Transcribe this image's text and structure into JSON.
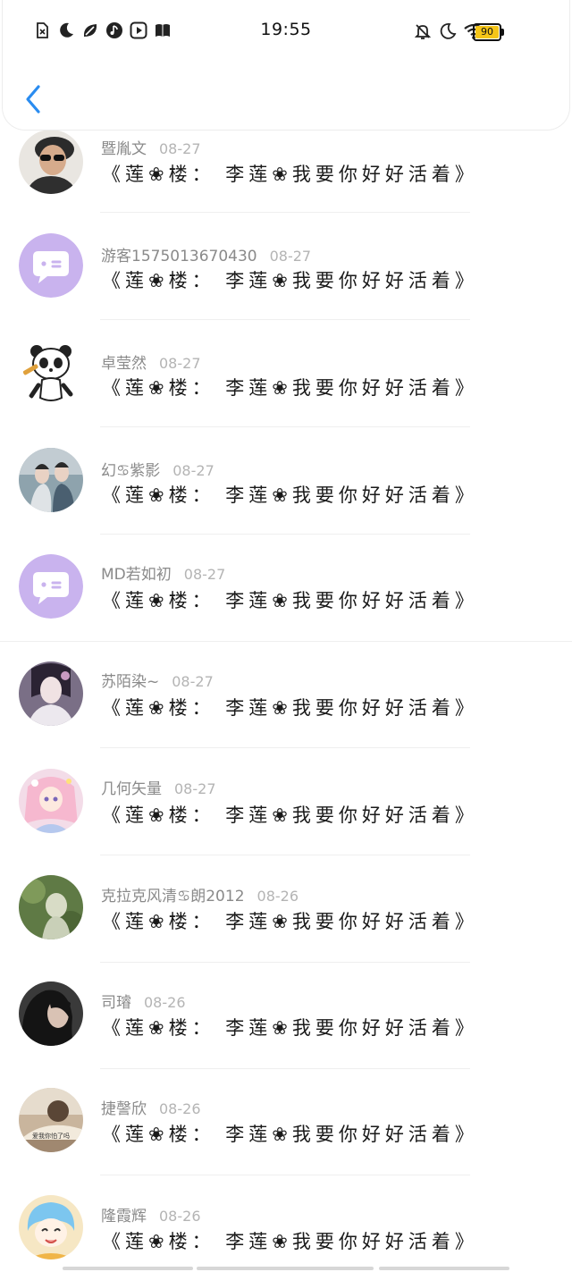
{
  "status_bar": {
    "time": "19:55",
    "battery": "90",
    "left_icons": [
      "sim-off-icon",
      "moon-icon",
      "leaf-icon",
      "music-icon",
      "video-play-icon",
      "book-icon"
    ],
    "right_icons": [
      "bell-off-icon",
      "moon-icon",
      "wifi-icon",
      "battery-icon"
    ]
  },
  "header": {
    "back_icon": "chevron-left-icon"
  },
  "comments": [
    {
      "name": "暨胤文",
      "date": "08-27",
      "text": "《莲❀楼： 李莲❀我要你好好活着》",
      "avatar": "photo-man-sunglasses"
    },
    {
      "name": "游客1575013670430",
      "date": "08-27",
      "text": "《莲❀楼： 李莲❀我要你好好活着》",
      "avatar": "default-chat-bubble"
    },
    {
      "name": "卓莹然",
      "date": "08-27",
      "text": "《莲❀楼： 李莲❀我要你好好活着》",
      "avatar": "cartoon-panda"
    },
    {
      "name": "幻♋紫影",
      "date": "08-27",
      "text": "《莲❀楼： 李莲❀我要你好好活着》",
      "avatar": "photo-drama-couple"
    },
    {
      "name": "MD若如初",
      "date": "08-27",
      "text": "《莲❀楼： 李莲❀我要你好好活着》",
      "avatar": "default-chat-bubble"
    },
    {
      "name": "苏陌染~",
      "date": "08-27",
      "text": "《莲❀楼： 李莲❀我要你好好活着》",
      "avatar": "photo-costume-woman"
    },
    {
      "name": "几何矢量",
      "date": "08-27",
      "text": "《莲❀楼： 李莲❀我要你好好活着》",
      "avatar": "anime-girl-pink"
    },
    {
      "name": "克拉克风清♋朗2012",
      "date": "08-26",
      "text": "《莲❀楼： 李莲❀我要你好好活着》",
      "avatar": "photo-green-garden"
    },
    {
      "name": "司璿",
      "date": "08-26",
      "text": "《莲❀楼： 李莲❀我要你好好活着》",
      "avatar": "photo-dark-portrait"
    },
    {
      "name": "捷謦欣",
      "date": "08-26",
      "text": "《莲❀楼： 李莲❀我要你好好活着》",
      "avatar": "photo-reading-with-caption",
      "avatar_caption": "爱我你怕了吗"
    },
    {
      "name": "隆霞辉",
      "date": "08-26",
      "text": "《莲❀楼： 李莲❀我要你好好活着》",
      "avatar": "anime-blue-hair"
    }
  ],
  "colors": {
    "accent": "#2a8cf0",
    "default_avatar": "#c9b3ee",
    "battery_fill": "#f5c518",
    "name_text": "#8a8a8a",
    "date_text": "#b4b4b4"
  }
}
